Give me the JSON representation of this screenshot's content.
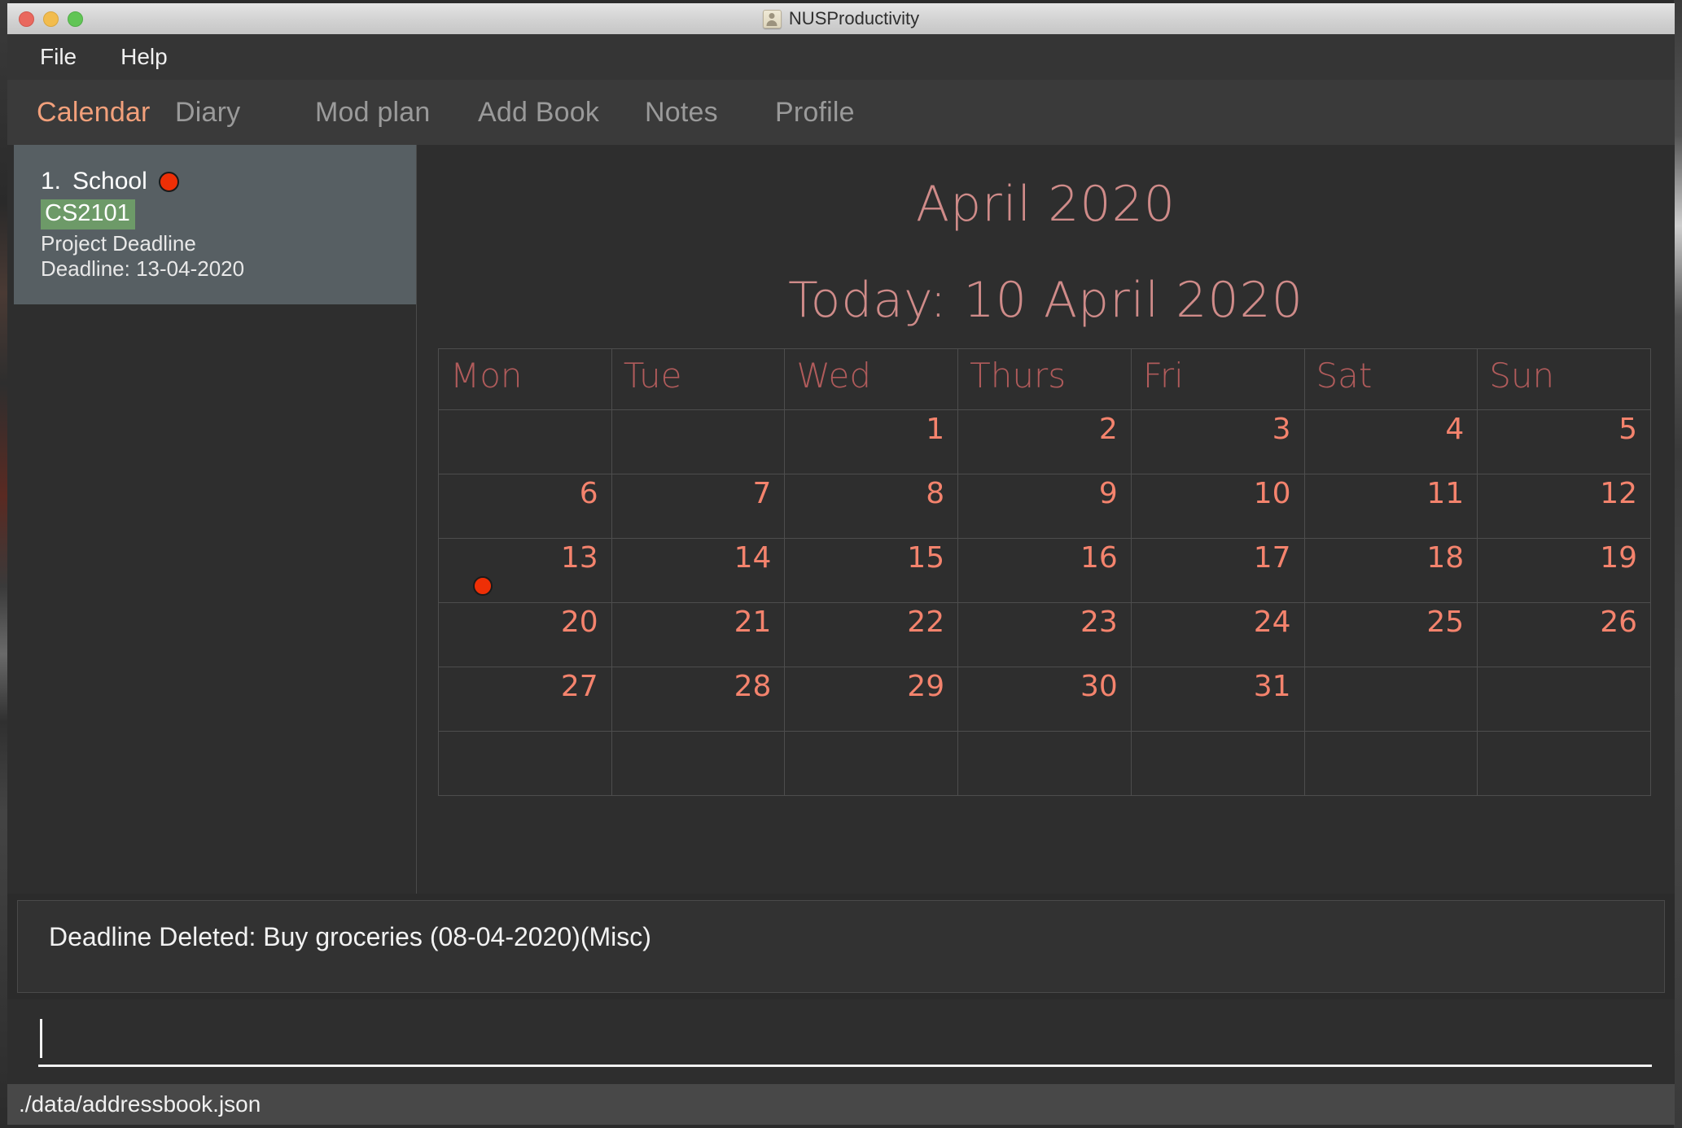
{
  "window": {
    "title": "NUSProductivity",
    "app_icon": "contact-card-icon",
    "traffic_lights": [
      "close-button",
      "minimize-button",
      "zoom-button"
    ]
  },
  "menubar": {
    "items": [
      {
        "label": "File"
      },
      {
        "label": "Help"
      }
    ]
  },
  "tabs": {
    "active": "Calendar",
    "items": [
      {
        "label": "Calendar",
        "active": true
      },
      {
        "label": "Diary",
        "active": false
      },
      {
        "label": "Mod plan",
        "active": false
      },
      {
        "label": "Add Book",
        "active": false
      },
      {
        "label": "Notes",
        "active": false
      },
      {
        "label": "Profile",
        "active": false
      }
    ]
  },
  "sidebar": {
    "cards": [
      {
        "index": "1.",
        "name": "School",
        "priority_dot": "red",
        "tag": "CS2101",
        "description": "Project Deadline",
        "deadline": "Deadline: 13-04-2020"
      }
    ]
  },
  "calendar": {
    "month_title": "April 2020",
    "today_label": "Today: 10 April 2020",
    "day_headers": [
      "Mon",
      "Tue",
      "Wed",
      "Thurs",
      "Fri",
      "Sat",
      "Sun"
    ],
    "weeks": [
      [
        "",
        "",
        "1",
        "2",
        "3",
        "4",
        "5"
      ],
      [
        "6",
        "7",
        "8",
        "9",
        "10",
        "11",
        "12"
      ],
      [
        "13",
        "14",
        "15",
        "16",
        "17",
        "18",
        "19"
      ],
      [
        "20",
        "21",
        "22",
        "23",
        "24",
        "25",
        "26"
      ],
      [
        "27",
        "28",
        "29",
        "30",
        "31",
        "",
        ""
      ],
      [
        "",
        "",
        "",
        "",
        "",
        "",
        ""
      ]
    ],
    "event_markers": [
      {
        "week": 2,
        "day": 0,
        "date": "13",
        "color": "#ee2f06"
      }
    ]
  },
  "result_display": {
    "text": "Deadline Deleted: Buy groceries (08-04-2020)(Misc)"
  },
  "command_input": {
    "value": "",
    "placeholder": ""
  },
  "status_footer": {
    "path": "./data/addressbook.json"
  },
  "colors": {
    "accent": "#f2a07b",
    "calendar_text": "#cf8b89",
    "day_number": "#f4836d",
    "day_header": "#b05b5b",
    "priority_red": "#ee2f06",
    "tag_green": "#6d9a68",
    "panel_bg": "#2e2e2e",
    "card_bg": "#575f63"
  }
}
